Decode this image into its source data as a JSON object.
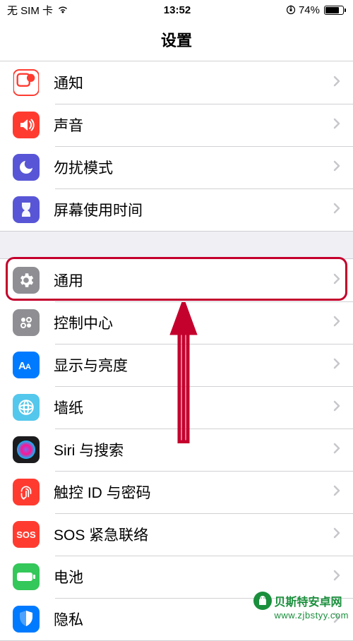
{
  "status": {
    "left": "无 SIM 卡",
    "time": "13:52",
    "battery_pct": "74%"
  },
  "title": "设置",
  "groups": [
    {
      "rows": [
        {
          "label": "通知",
          "icon": "notifications-icon",
          "bg": "bg-white"
        },
        {
          "label": "声音",
          "icon": "sound-icon",
          "bg": "bg-red"
        },
        {
          "label": "勿扰模式",
          "icon": "dnd-icon",
          "bg": "bg-purple"
        },
        {
          "label": "屏幕使用时间",
          "icon": "screentime-icon",
          "bg": "bg-purple"
        }
      ]
    },
    {
      "rows": [
        {
          "label": "通用",
          "icon": "general-icon",
          "bg": "bg-gray"
        },
        {
          "label": "控制中心",
          "icon": "control-center-icon",
          "bg": "bg-gray"
        },
        {
          "label": "显示与亮度",
          "icon": "display-icon",
          "bg": "bg-blue"
        },
        {
          "label": "墙纸",
          "icon": "wallpaper-icon",
          "bg": "bg-cyan"
        },
        {
          "label": "Siri 与搜索",
          "icon": "siri-icon",
          "bg": "bg-black"
        },
        {
          "label": "触控 ID 与密码",
          "icon": "touchid-icon",
          "bg": "bg-red"
        },
        {
          "label": "SOS 紧急联络",
          "icon": "sos-icon",
          "bg": "bg-red",
          "text": "SOS"
        },
        {
          "label": "电池",
          "icon": "battery-icon",
          "bg": "bg-green"
        },
        {
          "label": "隐私",
          "icon": "privacy-icon",
          "bg": "bg-blue"
        }
      ]
    }
  ],
  "watermark": {
    "line1": "贝斯特安卓网",
    "line2": "www.zjbstyy.com"
  }
}
